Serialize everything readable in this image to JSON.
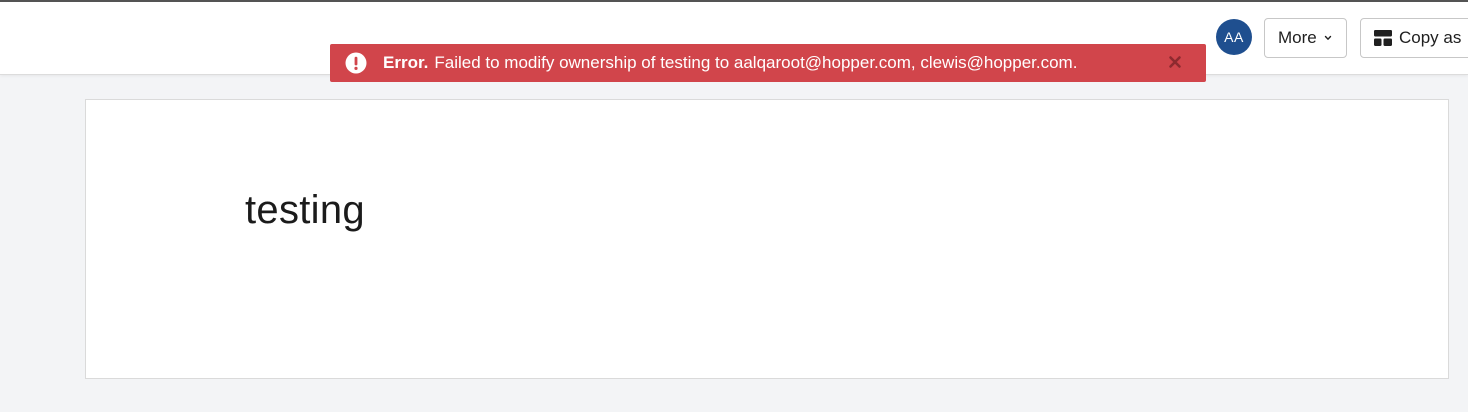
{
  "header": {
    "avatar_initials": "AA",
    "more_label": "More",
    "copy_as_label": "Copy as",
    "icons": {
      "more_caret": "chevron-down-icon",
      "copy_as": "layout-template-icon"
    }
  },
  "error_banner": {
    "prefix": "Error.",
    "message": "Failed to modify ownership of testing to aalqaroot@hopper.com, clewis@hopper.com.",
    "color": "#d1454b",
    "icons": {
      "alert": "exclamation-circle-icon",
      "close": "close-icon"
    }
  },
  "card": {
    "title": "testing"
  },
  "colors": {
    "avatar": "#1f4f8f",
    "page_background": "#f3f4f6"
  }
}
